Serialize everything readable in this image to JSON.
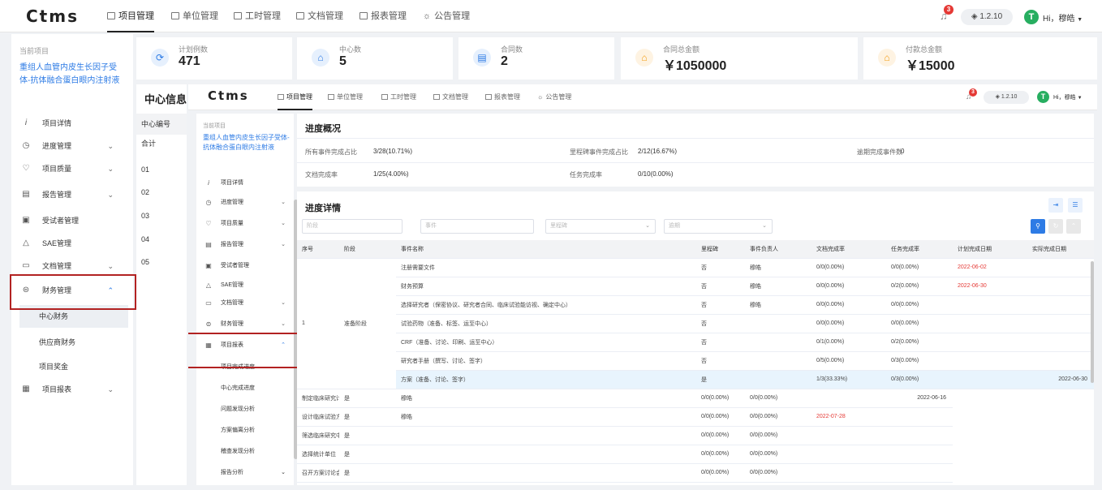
{
  "app": {
    "logo": "Ctms",
    "version": "1.2.10",
    "badge_count": "3",
    "avatar_letter": "T",
    "greeting": "Hi，穆皓"
  },
  "nav": [
    "项目管理",
    "单位管理",
    "工时管理",
    "文档管理",
    "报表管理",
    "公告管理"
  ],
  "sidebar": {
    "current_label": "当前项目",
    "project_name": "重组人血管内皮生长因子受体-抗体融合蛋白眼内注射液",
    "items": [
      {
        "icon": "i",
        "label": "项目详情",
        "chevron": ""
      },
      {
        "icon": "◷",
        "label": "进度管理",
        "chevron": "⌄"
      },
      {
        "icon": "♡",
        "label": "项目质量",
        "chevron": "⌄"
      },
      {
        "icon": "▤",
        "label": "报告管理",
        "chevron": "⌄"
      },
      {
        "icon": "▣",
        "label": "受试者管理",
        "chevron": ""
      },
      {
        "icon": "△",
        "label": "SAE管理",
        "chevron": ""
      },
      {
        "icon": "▭",
        "label": "文档管理",
        "chevron": "⌄"
      },
      {
        "icon": "⊜",
        "label": "财务管理",
        "chevron": "⌃"
      }
    ],
    "finance_sub": [
      "中心财务",
      "供应商财务",
      "项目奖金"
    ],
    "report_item": {
      "icon": "▦",
      "label": "项目报表",
      "chevron": "⌄"
    }
  },
  "stats": [
    {
      "label": "计划例数",
      "value": "471",
      "icon": "⟳",
      "color": "#2d7be5",
      "bg": "#e6f0fd"
    },
    {
      "label": "中心数",
      "value": "5",
      "icon": "⌂",
      "color": "#2d7be5",
      "bg": "#e6f0fd"
    },
    {
      "label": "合同数",
      "value": "2",
      "icon": "▤",
      "color": "#2d7be5",
      "bg": "#e6f0fd"
    },
    {
      "label": "合同总金额",
      "value": "￥1050000",
      "icon": "⌂",
      "color": "#f39c12",
      "bg": "#fef3e2"
    },
    {
      "label": "付款总金额",
      "value": "￥15000",
      "icon": "⌂",
      "color": "#f39c12",
      "bg": "#fef3e2"
    }
  ],
  "center_info": {
    "title": "中心信息",
    "col_header": "中心编号",
    "rows": [
      "合计",
      "01",
      "02",
      "03",
      "04",
      "05"
    ]
  },
  "inner": {
    "logo": "Ctms",
    "version": "1.2.10",
    "badge_count": "3",
    "avatar_letter": "T",
    "greeting": "Hi，穆皓",
    "nav": [
      "项目管理",
      "单位管理",
      "工时管理",
      "文档管理",
      "报表管理",
      "公告管理"
    ],
    "sidebar": {
      "current_label": "当前项目",
      "project_name": "重组人血管内皮生长因子受体-抗体融合蛋白眼内注射液",
      "items": [
        {
          "icon": "i",
          "label": "项目详情",
          "chevron": ""
        },
        {
          "icon": "◷",
          "label": "进度管理",
          "chevron": "⌄"
        },
        {
          "icon": "♡",
          "label": "项目质量",
          "chevron": "⌄"
        },
        {
          "icon": "▤",
          "label": "报告管理",
          "chevron": "⌄"
        },
        {
          "icon": "▣",
          "label": "受试者管理",
          "chevron": ""
        },
        {
          "icon": "△",
          "label": "SAE管理",
          "chevron": ""
        },
        {
          "icon": "▭",
          "label": "文档管理",
          "chevron": "⌄"
        },
        {
          "icon": "⊜",
          "label": "财务管理",
          "chevron": "⌄"
        },
        {
          "icon": "▦",
          "label": "项目报表",
          "chevron": "⌃"
        }
      ],
      "report_sub": [
        "项目完成进度",
        "中心完成进度",
        "问题发现分析",
        "方案偏离分析",
        "稽查发现分析",
        "报告分析"
      ]
    },
    "overview": {
      "title": "进度概况",
      "items": [
        {
          "label": "所有事件完成占比",
          "value": "3/28(10.71%)"
        },
        {
          "label": "里程碑事件完成占比",
          "value": "2/12(16.67%)"
        },
        {
          "label": "逾期完成事件数",
          "value": "0"
        },
        {
          "label": "文档完成率",
          "value": "1/25(4.00%)"
        },
        {
          "label": "任务完成率",
          "value": "0/10(0.00%)"
        }
      ]
    },
    "detail": {
      "title": "进度详情",
      "filters": {
        "stage": "阶段",
        "event": "事件",
        "milestone": "里程碑",
        "deadline": "逾期"
      },
      "columns": [
        "序号",
        "阶段",
        "事件名称",
        "里程碑",
        "事件负责人",
        "文档完成率",
        "任务完成率",
        "计划完成日期",
        "实际完成日期"
      ],
      "group_index": "1",
      "group_stage": "准备阶段",
      "rows": [
        {
          "name": "注册需要文件",
          "milestone": "否",
          "owner": "穆皓",
          "doc": "0/0(0.00%)",
          "task": "0/0(0.00%)",
          "plan": "2022-06-02",
          "actual": ""
        },
        {
          "name": "财务预算",
          "milestone": "否",
          "owner": "穆皓",
          "doc": "0/0(0.00%)",
          "task": "0/2(0.00%)",
          "plan": "2022-06-30",
          "actual": ""
        },
        {
          "name": "选择研究者（保密协议、研究者合同、临床试验能访视、确定中心）",
          "milestone": "否",
          "owner": "穆皓",
          "doc": "0/0(0.00%)",
          "task": "0/0(0.00%)",
          "plan": "",
          "actual": ""
        },
        {
          "name": "试验药物（准备、标签、运至中心）",
          "milestone": "否",
          "owner": "",
          "doc": "0/0(0.00%)",
          "task": "0/0(0.00%)",
          "plan": "",
          "actual": ""
        },
        {
          "name": "CRF（准备、讨论、印刷、运至中心）",
          "milestone": "否",
          "owner": "",
          "doc": "0/1(0.00%)",
          "task": "0/2(0.00%)",
          "plan": "",
          "actual": ""
        },
        {
          "name": "研究者手册（撰写、讨论、签字）",
          "milestone": "否",
          "owner": "",
          "doc": "0/5(0.00%)",
          "task": "0/3(0.00%)",
          "plan": "",
          "actual": ""
        },
        {
          "name": "方案（准备、讨论、签字）",
          "milestone": "是",
          "owner": "",
          "doc": "1/3(33.33%)",
          "task": "0/3(0.00%)",
          "plan": "",
          "actual": "2022-06-30",
          "highlight": true
        },
        {
          "name": "制定临床研究计划",
          "milestone": "是",
          "owner": "穆皓",
          "doc": "0/0(0.00%)",
          "task": "0/0(0.00%)",
          "plan": "",
          "actual": "2022-06-16"
        },
        {
          "name": "设计临床试验方案",
          "milestone": "是",
          "owner": "穆皓",
          "doc": "0/0(0.00%)",
          "task": "0/0(0.00%)",
          "plan": "2022-07-28",
          "actual": ""
        },
        {
          "name": "筛选临床研究中心",
          "milestone": "是",
          "owner": "",
          "doc": "0/0(0.00%)",
          "task": "0/0(0.00%)",
          "plan": "",
          "actual": ""
        },
        {
          "name": "选择统计单位",
          "milestone": "是",
          "owner": "",
          "doc": "0/0(0.00%)",
          "task": "0/0(0.00%)",
          "plan": "",
          "actual": ""
        },
        {
          "name": "召开方案讨论会",
          "milestone": "是",
          "owner": "",
          "doc": "0/0(0.00%)",
          "task": "0/0(0.00%)",
          "plan": "",
          "actual": ""
        }
      ]
    }
  }
}
